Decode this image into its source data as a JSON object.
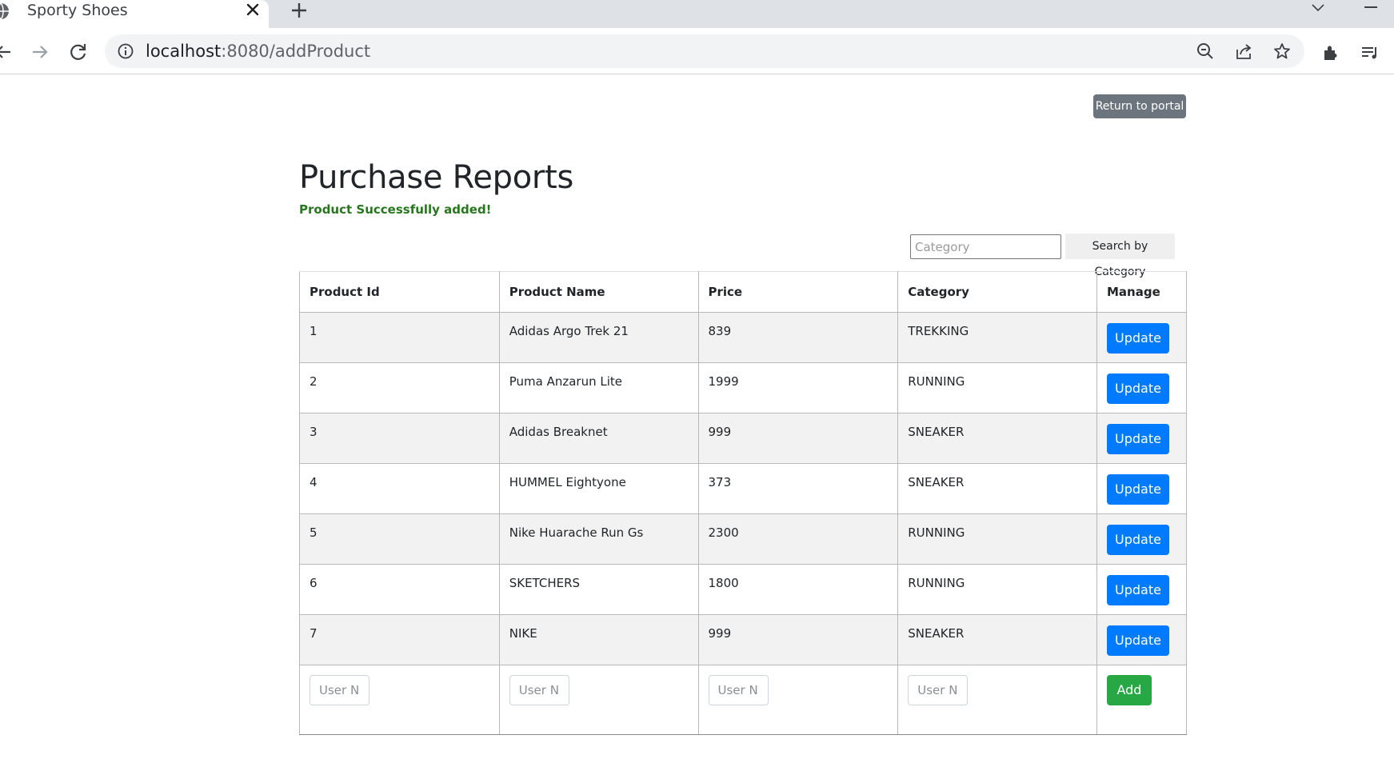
{
  "browser": {
    "tab_title": "Sporty Shoes",
    "url_host": "localhost",
    "url_rest": ":8080/addProduct"
  },
  "page": {
    "return_label": "Return to portal",
    "title": "Purchase Reports",
    "success_message": "Product Successfully added!",
    "search": {
      "placeholder": "Category",
      "button_label": "Search by Category"
    }
  },
  "table": {
    "headers": [
      "Product Id",
      "Product Name",
      "Price",
      "Category",
      "Manage"
    ],
    "rows": [
      {
        "id": "1",
        "name": "Adidas Argo Trek 21",
        "price": "839",
        "category": "TREKKING",
        "action": "Update"
      },
      {
        "id": "2",
        "name": "Puma Anzarun Lite",
        "price": "1999",
        "category": "RUNNING",
        "action": "Update"
      },
      {
        "id": "3",
        "name": "Adidas Breaknet",
        "price": "999",
        "category": "SNEAKER",
        "action": "Update"
      },
      {
        "id": "4",
        "name": "HUMMEL Eightyone",
        "price": "373",
        "category": "SNEAKER",
        "action": "Update"
      },
      {
        "id": "5",
        "name": "Nike Huarache Run Gs",
        "price": "2300",
        "category": "RUNNING",
        "action": "Update"
      },
      {
        "id": "6",
        "name": "SKETCHERS",
        "price": "1800",
        "category": "RUNNING",
        "action": "Update"
      },
      {
        "id": "7",
        "name": "NIKE",
        "price": "999",
        "category": "SNEAKER",
        "action": "Update"
      }
    ],
    "new_row": {
      "placeholders": [
        "User N",
        "User N",
        "User N",
        "User N"
      ],
      "add_label": "Add"
    }
  },
  "colors": {
    "update_button": "#007bff",
    "add_button": "#28a745",
    "return_button": "#6c757d",
    "success_text": "#28761f"
  }
}
